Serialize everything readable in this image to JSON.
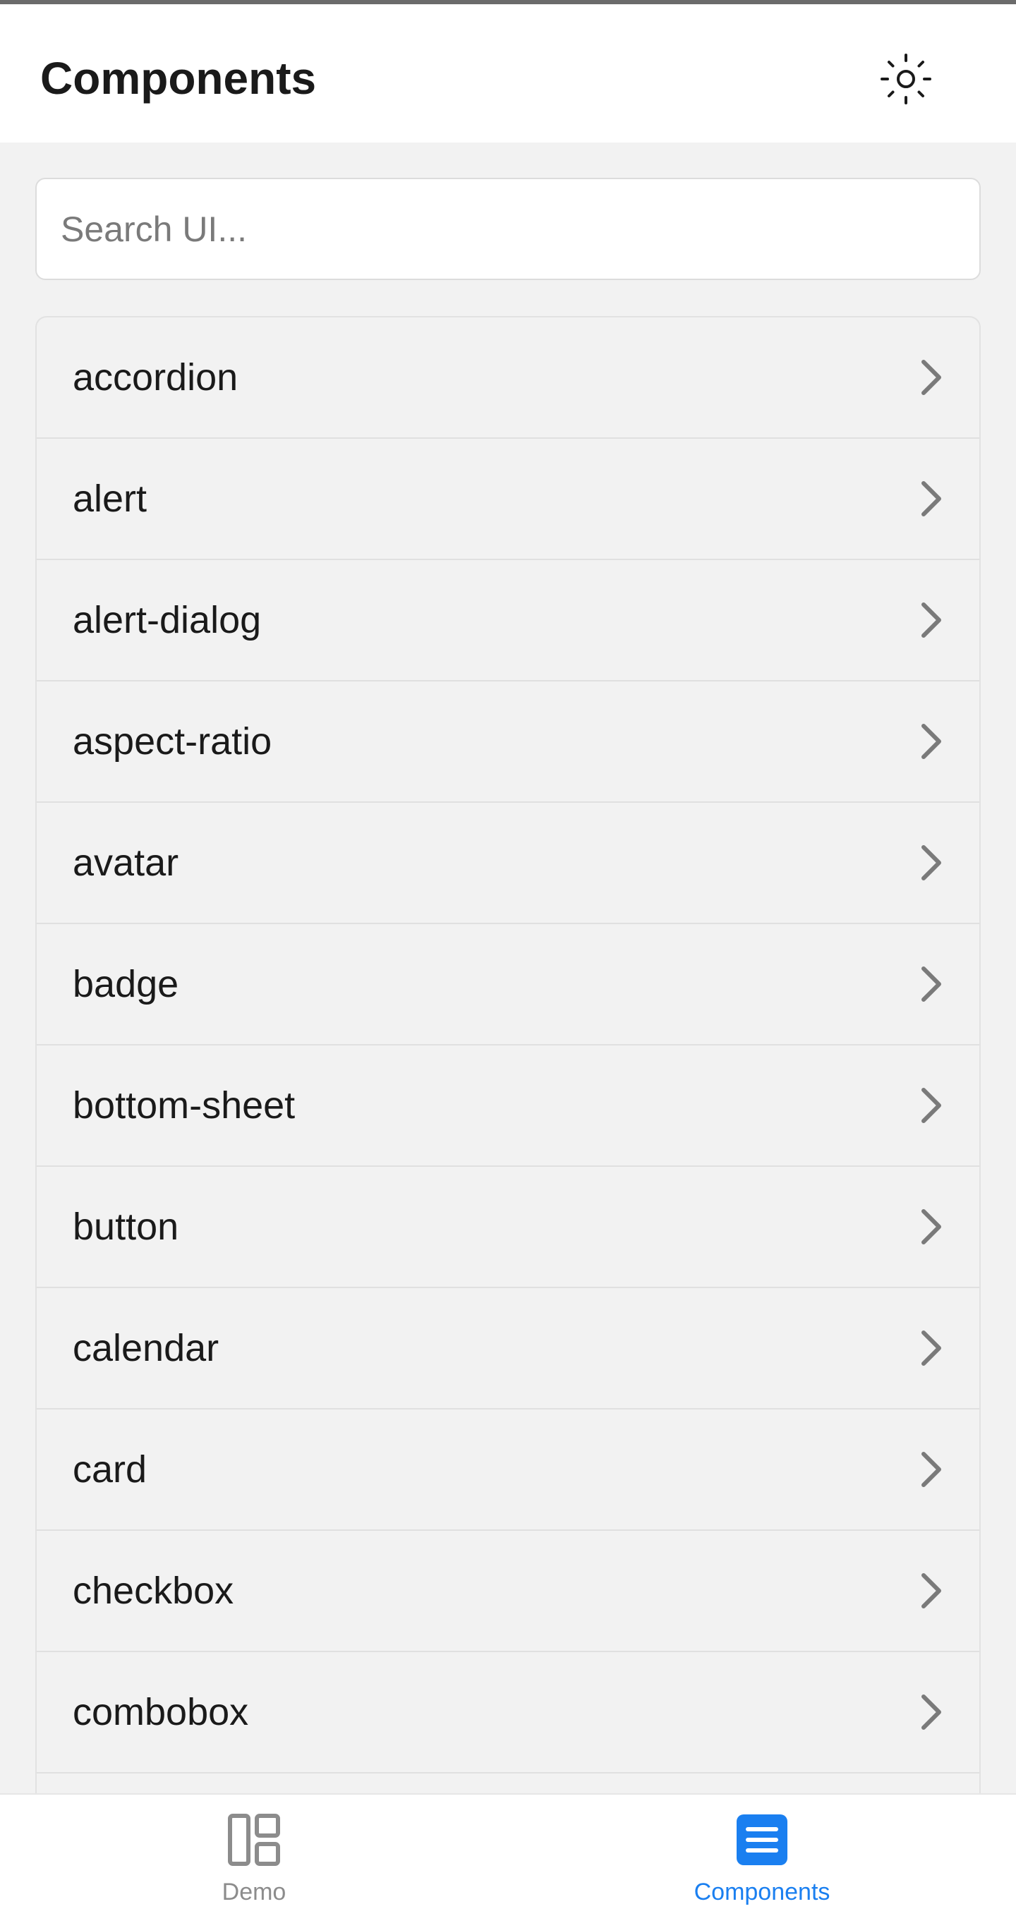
{
  "header": {
    "title": "Components",
    "theme_icon": "sun-icon"
  },
  "search": {
    "placeholder": "Search UI...",
    "value": ""
  },
  "components": {
    "items": [
      {
        "label": "accordion"
      },
      {
        "label": "alert"
      },
      {
        "label": "alert-dialog"
      },
      {
        "label": "aspect-ratio"
      },
      {
        "label": "avatar"
      },
      {
        "label": "badge"
      },
      {
        "label": "bottom-sheet"
      },
      {
        "label": "button"
      },
      {
        "label": "calendar"
      },
      {
        "label": "card"
      },
      {
        "label": "checkbox"
      },
      {
        "label": "combobox"
      }
    ],
    "item_icon": "chevron-right-icon"
  },
  "bottom_nav": {
    "tabs": [
      {
        "label": "Demo",
        "icon": "layout-icon",
        "active": false
      },
      {
        "label": "Components",
        "icon": "list-icon",
        "active": true
      }
    ]
  },
  "colors": {
    "accent": "#1a7ff0",
    "inactive": "#8c8c8c",
    "background": "#f2f2f2",
    "surface": "#ffffff"
  }
}
